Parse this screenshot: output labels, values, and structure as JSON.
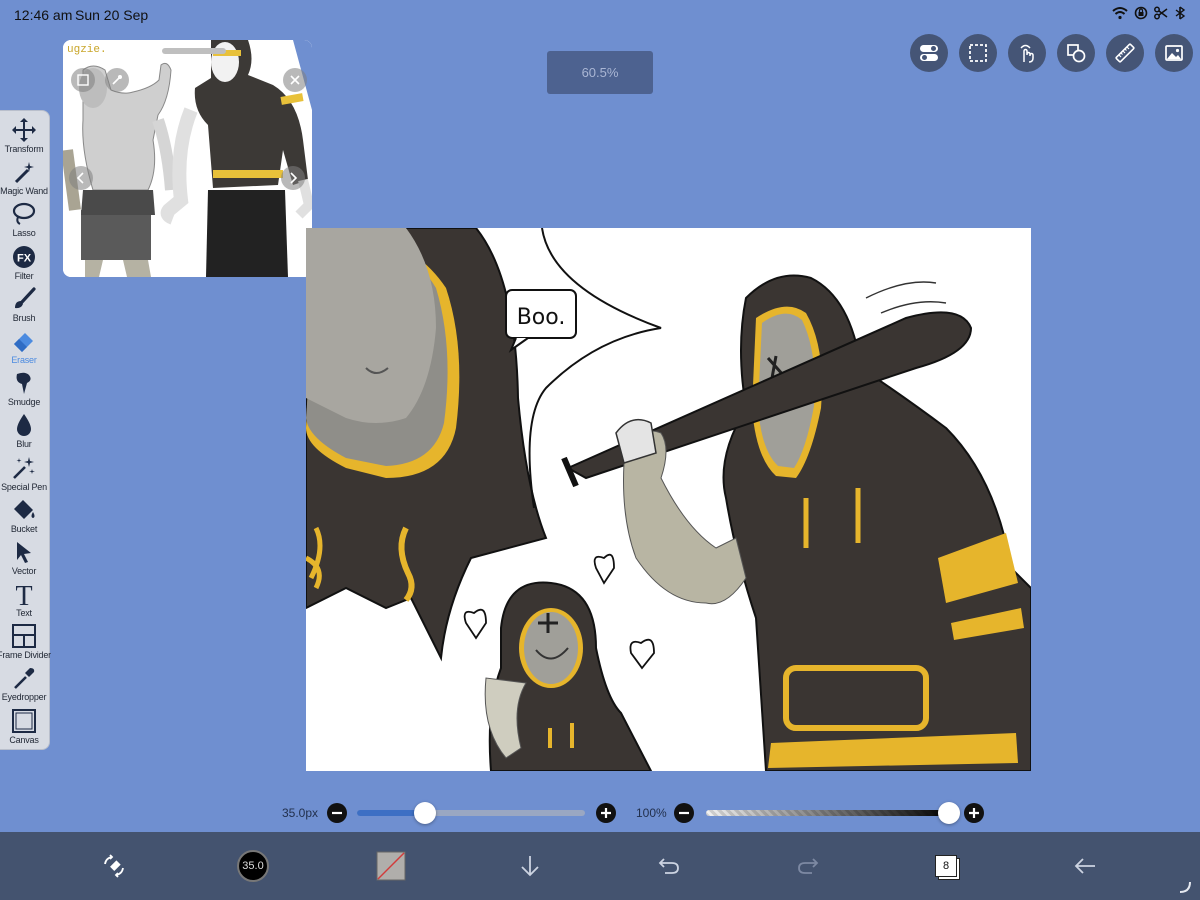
{
  "status_bar": {
    "time": "12:46 am",
    "date": "Sun 20 Sep",
    "icons": [
      "wifi-icon",
      "orientation-lock-icon",
      "scissors-icon",
      "battery-icon"
    ]
  },
  "zoom": {
    "label": "60.5%"
  },
  "top_tools": [
    {
      "name": "settings-toggle-icon"
    },
    {
      "name": "selection-icon"
    },
    {
      "name": "gesture-icon"
    },
    {
      "name": "shapes-icon"
    },
    {
      "name": "ruler-icon"
    },
    {
      "name": "gallery-icon"
    }
  ],
  "toolbar": {
    "tools": [
      {
        "label": "Transform",
        "icon": "move-arrows-icon"
      },
      {
        "label": "Magic Wand",
        "icon": "magic-wand-icon"
      },
      {
        "label": "Lasso",
        "icon": "lasso-icon"
      },
      {
        "label": "Filter",
        "icon": "fx-icon",
        "glyph": "FX"
      },
      {
        "label": "Brush",
        "icon": "brush-icon"
      },
      {
        "label": "Eraser",
        "icon": "eraser-icon",
        "active": true
      },
      {
        "label": "Smudge",
        "icon": "smudge-icon"
      },
      {
        "label": "Blur",
        "icon": "drop-icon"
      },
      {
        "label": "Special Pen",
        "icon": "sparkle-pen-icon"
      },
      {
        "label": "Bucket",
        "icon": "bucket-icon"
      },
      {
        "label": "Vector",
        "icon": "cursor-arrow-icon"
      },
      {
        "label": "Text",
        "icon": "text-icon",
        "glyph": "T"
      },
      {
        "label": "Frame Divider",
        "icon": "frame-divider-icon"
      },
      {
        "label": "Eyedropper",
        "icon": "eyedropper-icon"
      },
      {
        "label": "Canvas",
        "icon": "canvas-icon"
      }
    ],
    "active_color": "#4c8be0"
  },
  "reference": {
    "caption_fragment": "ugzie."
  },
  "canvas": {
    "speech_text": "Boo."
  },
  "sliders": {
    "size": {
      "label": "35.0px",
      "fraction": 0.3
    },
    "opacity": {
      "label": "100%",
      "fraction": 1.0
    }
  },
  "bottom_bar": {
    "brush_size": "35.0",
    "layers_count": "8",
    "buttons": [
      "transform-mode-icon",
      "brush-size-icon",
      "color-swatch-icon",
      "download-icon",
      "undo-icon",
      "redo-icon",
      "layers-icon",
      "back-arrow-icon"
    ]
  }
}
